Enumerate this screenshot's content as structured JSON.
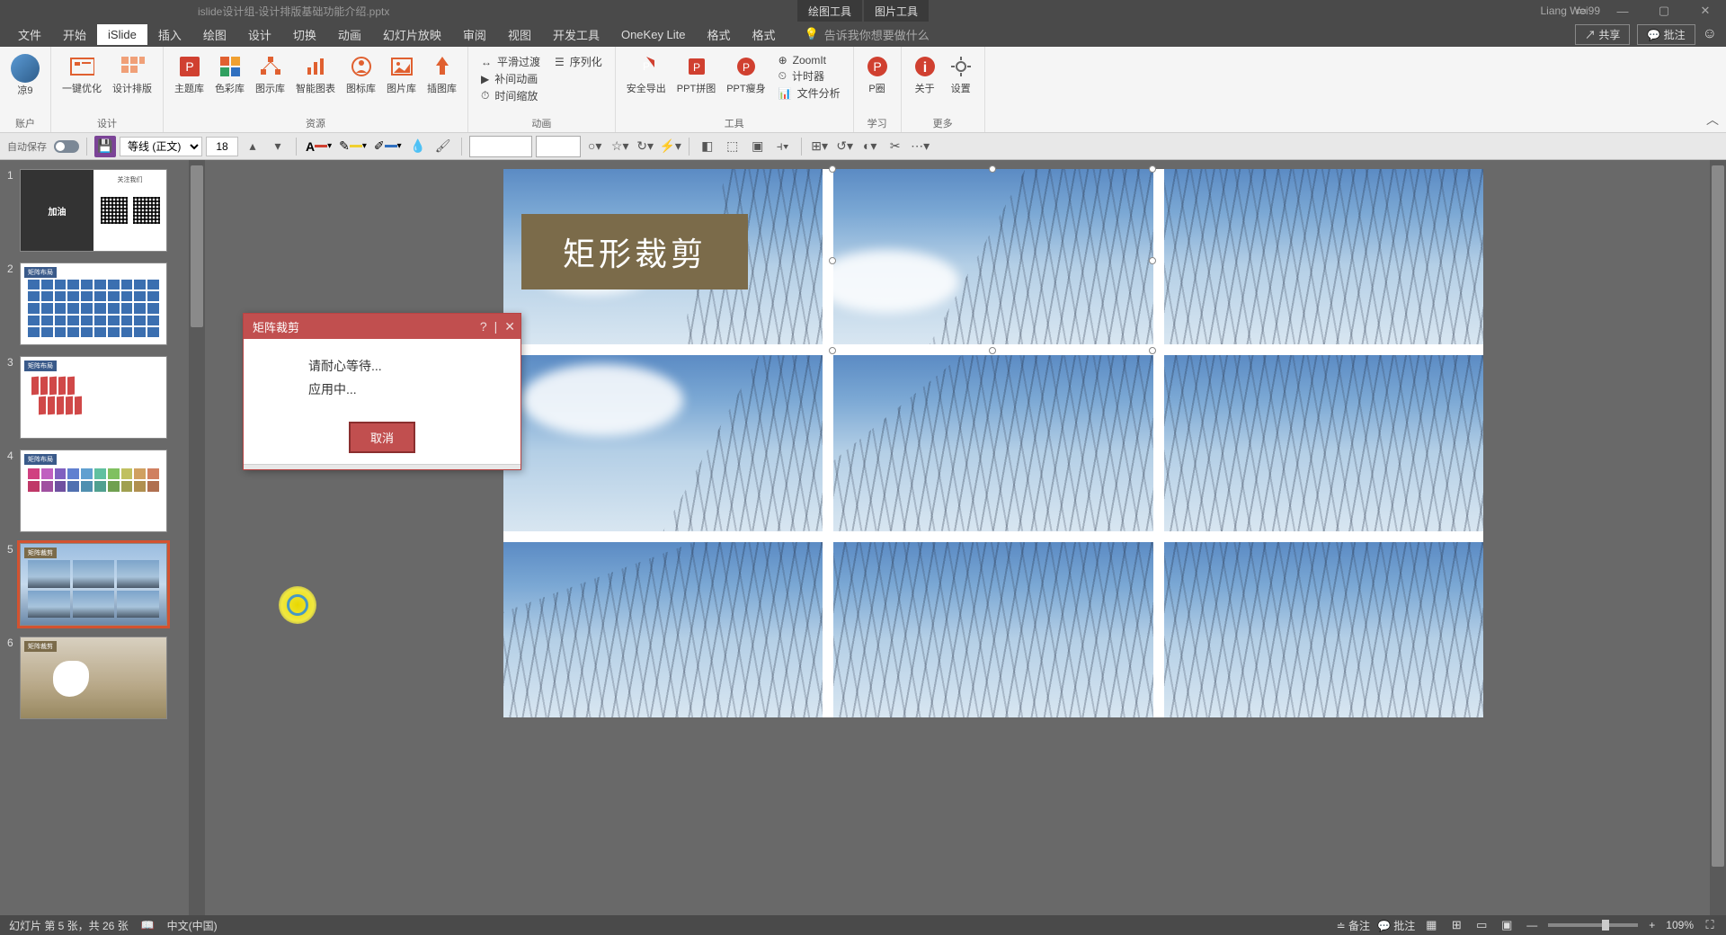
{
  "titlebar": {
    "filename": "islide设计组-设计排版基础功能介绍.pptx",
    "tools": [
      "绘图工具",
      "图片工具"
    ],
    "username": "Liang Wei99"
  },
  "menu": {
    "items": [
      "文件",
      "开始",
      "iSlide",
      "插入",
      "绘图",
      "设计",
      "切换",
      "动画",
      "幻灯片放映",
      "审阅",
      "视图",
      "开发工具",
      "OneKey Lite",
      "格式",
      "格式"
    ],
    "active_index": 2,
    "search_placeholder": "告诉我你想要做什么",
    "share": "共享",
    "comment": "批注"
  },
  "ribbon": {
    "account": {
      "label": "账户",
      "user": "凉9"
    },
    "design": {
      "label": "设计",
      "btn1": "一键优化",
      "btn2": "设计排版"
    },
    "resource": {
      "label": "资源",
      "btns": [
        "主题库",
        "色彩库",
        "图示库",
        "智能图表",
        "图标库",
        "图片库",
        "插图库"
      ]
    },
    "animation": {
      "label": "动画",
      "items": [
        "平滑过渡",
        "补间动画",
        "时间缩放"
      ],
      "extra": "序列化"
    },
    "tools": {
      "label": "工具",
      "btns": [
        "安全导出",
        "PPT拼图",
        "PPT瘦身"
      ],
      "items": [
        "ZoomIt",
        "计时器",
        "文件分析"
      ]
    },
    "learn": {
      "label": "学习",
      "btn": "P圈"
    },
    "more": {
      "label": "更多",
      "btns": [
        "关于",
        "设置"
      ]
    }
  },
  "toolbar": {
    "autosave": "自动保存",
    "font": "等线 (正文)",
    "size": "18"
  },
  "slides": {
    "items": [
      {
        "num": "1"
      },
      {
        "num": "2"
      },
      {
        "num": "3"
      },
      {
        "num": "4"
      },
      {
        "num": "5"
      },
      {
        "num": "6"
      }
    ],
    "selected": 4,
    "title_on_canvas": "矩形裁剪",
    "s1_text": "加油",
    "s1_follow": "关注我们",
    "s23_label": "矩阵布局",
    "s4_label": "矩阵布局",
    "s56_label": "矩阵裁剪"
  },
  "dialog": {
    "title": "矩阵裁剪",
    "line1": "请耐心等待...",
    "line2": "应用中...",
    "cancel": "取消"
  },
  "status": {
    "slide_info": "幻灯片 第 5 张，共 26 张",
    "lang": "中文(中国)",
    "notes": "备注",
    "comments": "批注",
    "zoom": "109%"
  },
  "colors": {
    "accent_red": "#c14f4f",
    "title_box": "#7b6b4a"
  }
}
